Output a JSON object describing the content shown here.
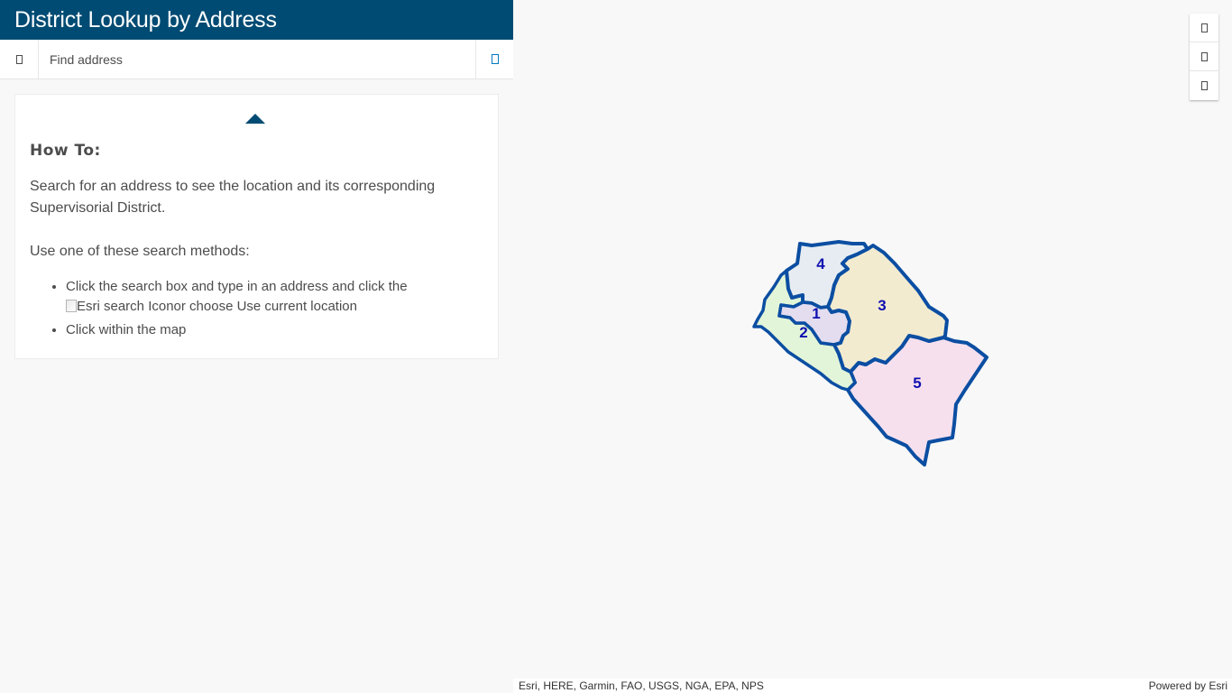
{
  "header": {
    "title": "District Lookup by Address"
  },
  "search": {
    "placeholder": "Find address",
    "value": ""
  },
  "info_panel": {
    "heading": "How To:",
    "intro": "Search for an address to see the location and its corresponding Supervisorial District.",
    "methods_intro": "Use one of these search methods:",
    "method_1_text": "Click the search box and type in an address and click the",
    "method_1_img_alt": "Esri search Icon",
    "method_1_suffix": "or choose Use current location",
    "method_2_text": "Click within the map"
  },
  "map": {
    "districts": [
      {
        "label": "1",
        "fill": "#e4dcef"
      },
      {
        "label": "2",
        "fill": "#e3f5d8"
      },
      {
        "label": "3",
        "fill": "#f3ebd0"
      },
      {
        "label": "4",
        "fill": "#e6ecf1"
      },
      {
        "label": "5",
        "fill": "#f6e0ee"
      }
    ],
    "boundary_color": "#0b4ea2",
    "label_color": "#1010b0"
  },
  "attribution": {
    "sources": "Esri, HERE, Garmin, FAO, USGS, NGA, EPA, NPS",
    "powered_by": "Powered by Esri"
  },
  "icons": {
    "search_source": "missing-glyph",
    "search_submit": "missing-glyph",
    "zoom_in": "missing-glyph",
    "zoom_out": "missing-glyph",
    "home": "missing-glyph"
  },
  "colors": {
    "header_bg": "#004b73",
    "accent": "#0079c1"
  }
}
